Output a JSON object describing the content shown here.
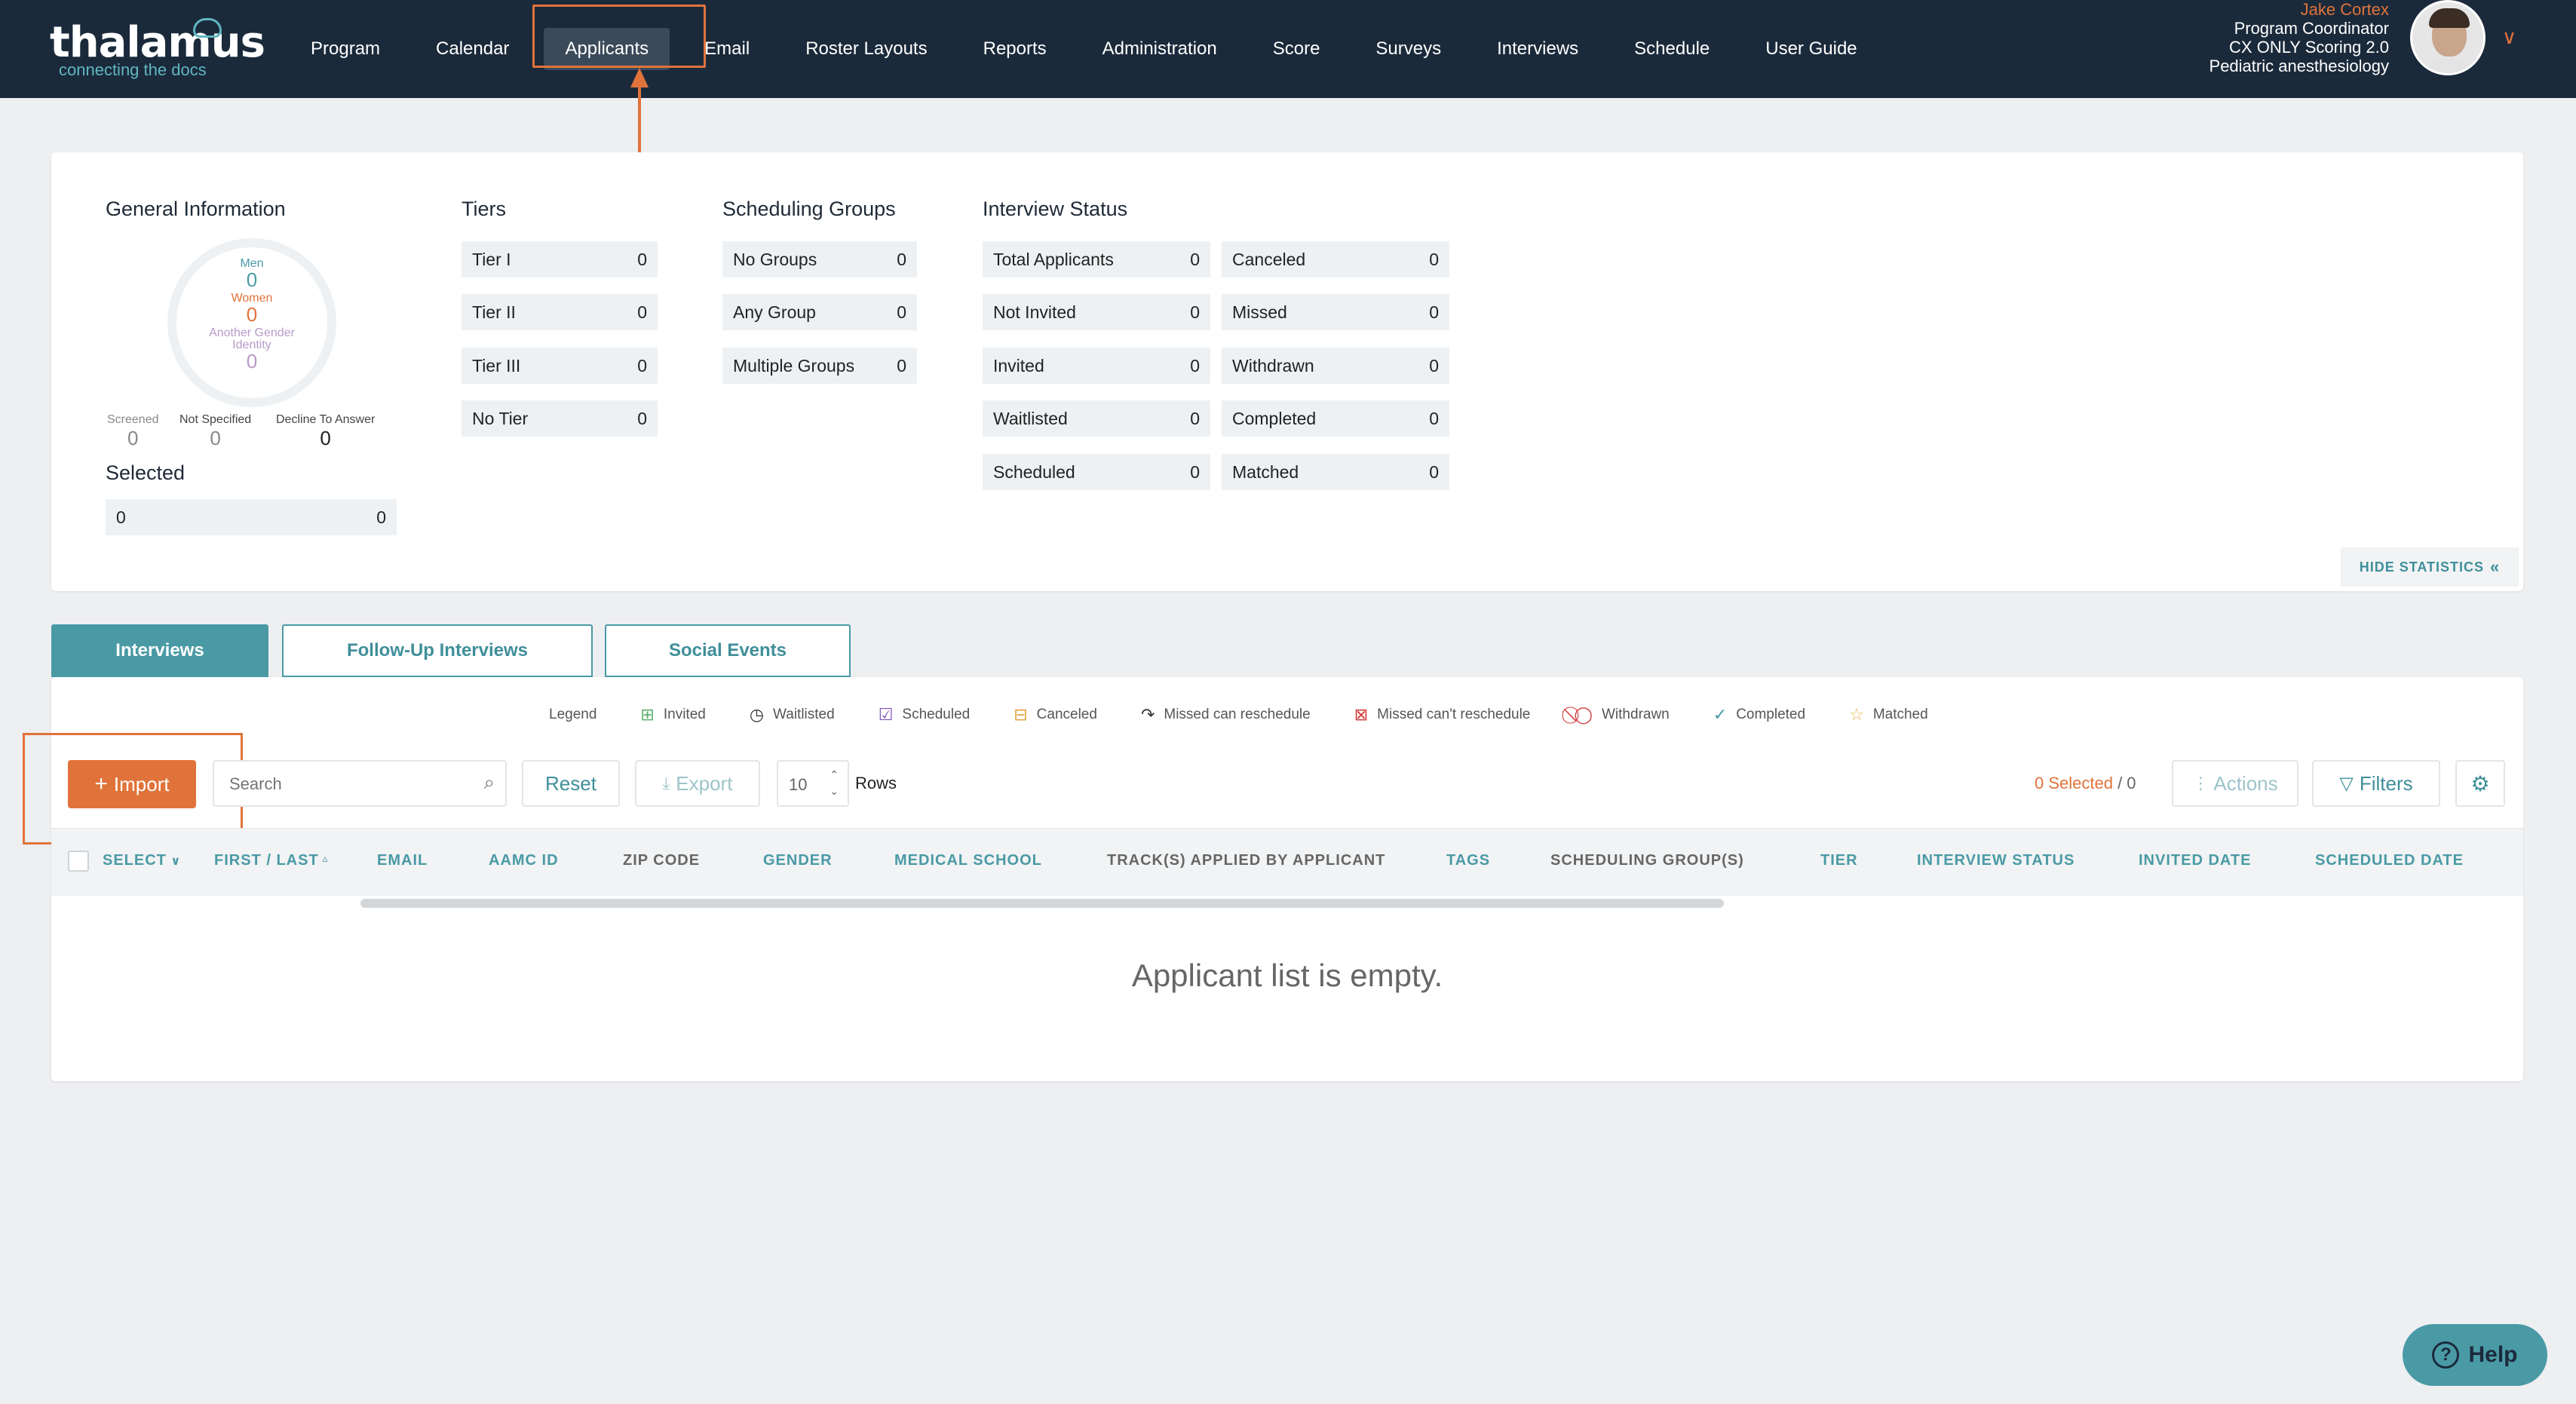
{
  "brand": {
    "name": "thalamus",
    "tagline": "connecting the docs"
  },
  "nav": {
    "items": [
      "Program",
      "Calendar",
      "Applicants",
      "Email",
      "Roster Layouts",
      "Reports",
      "Administration",
      "Score",
      "Surveys",
      "Interviews",
      "Schedule",
      "User Guide"
    ],
    "active": "Applicants"
  },
  "user": {
    "name": "Jake Cortex",
    "role": "Program Coordinator",
    "program": "CX ONLY Scoring 2.0",
    "specialty": "Pediatric anesthesiology"
  },
  "general_info": {
    "title": "General Information",
    "men_label": "Men",
    "men": "0",
    "women_label": "Women",
    "women": "0",
    "other_label": "Another Gender Identity",
    "other": "0",
    "screened_label": "Screened",
    "screened": "0",
    "not_specified_label": "Not Specified",
    "not_specified": "0",
    "decline_label": "Decline To Answer",
    "decline": "0",
    "selected_title": "Selected",
    "selected_left": "0",
    "selected_right": "0"
  },
  "tiers": {
    "title": "Tiers",
    "rows": [
      {
        "label": "Tier I",
        "value": "0"
      },
      {
        "label": "Tier II",
        "value": "0"
      },
      {
        "label": "Tier III",
        "value": "0"
      },
      {
        "label": "No Tier",
        "value": "0"
      }
    ]
  },
  "scheduling_groups": {
    "title": "Scheduling Groups",
    "rows": [
      {
        "label": "No Groups",
        "value": "0"
      },
      {
        "label": "Any Group",
        "value": "0"
      },
      {
        "label": "Multiple Groups",
        "value": "0"
      }
    ]
  },
  "interview_status": {
    "title": "Interview Status",
    "left": [
      {
        "label": "Total Applicants",
        "value": "0"
      },
      {
        "label": "Not Invited",
        "value": "0"
      },
      {
        "label": "Invited",
        "value": "0"
      },
      {
        "label": "Waitlisted",
        "value": "0"
      },
      {
        "label": "Scheduled",
        "value": "0"
      }
    ],
    "right": [
      {
        "label": "Canceled",
        "value": "0"
      },
      {
        "label": "Missed",
        "value": "0"
      },
      {
        "label": "Withdrawn",
        "value": "0"
      },
      {
        "label": "Completed",
        "value": "0"
      },
      {
        "label": "Matched",
        "value": "0"
      }
    ]
  },
  "hide_statistics": "HIDE STATISTICS",
  "tabs": [
    "Interviews",
    "Follow-Up Interviews",
    "Social Events"
  ],
  "legend": {
    "title": "Legend",
    "items": [
      "Invited",
      "Waitlisted",
      "Scheduled",
      "Canceled",
      "Missed can reschedule",
      "Missed can't reschedule",
      "Withdrawn",
      "Completed",
      "Matched"
    ]
  },
  "toolbar": {
    "import": "Import",
    "search_placeholder": "Search",
    "reset": "Reset",
    "export": "Export",
    "rows_value": "10",
    "rows_label": "Rows",
    "selected": "0 Selected",
    "total": " / 0",
    "actions": "Actions",
    "filters": "Filters"
  },
  "columns": [
    "SELECT",
    "FIRST / LAST",
    "EMAIL",
    "AAMC ID",
    "ZIP CODE",
    "GENDER",
    "MEDICAL SCHOOL",
    "TRACK(S) APPLIED BY APPLICANT",
    "TAGS",
    "SCHEDULING GROUP(S)",
    "TIER",
    "INTERVIEW STATUS",
    "INVITED DATE",
    "SCHEDULED DATE"
  ],
  "empty_message": "Applicant list is empty.",
  "help": "Help",
  "colors": {
    "accent": "#e0733a",
    "teal": "#4a9aa6",
    "navy": "#1b2a3b"
  }
}
